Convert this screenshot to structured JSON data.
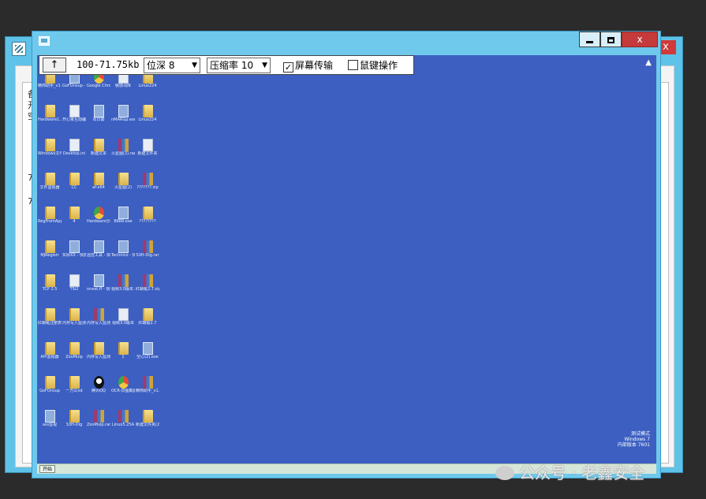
{
  "background_window": {
    "close_glyph": "x",
    "text_lines": [
      "备",
      "开",
      "空",
      "7",
      "7"
    ]
  },
  "main_window": {
    "min_label": "",
    "max_label": "",
    "close_label": "x"
  },
  "toolbar": {
    "up_label": "↑",
    "range": "100-71.75kb",
    "depth_select": "位深 8",
    "compress_select": "压缩率 10",
    "screen_transfer_label": "屏幕传输",
    "screen_transfer_checked": true,
    "input_control_label": "鼠键操作",
    "input_control_checked": false
  },
  "desktop": {
    "icons": [
      {
        "label": "精简助手_v1.87",
        "type": "folder"
      },
      {
        "label": "GoFOnsup - 快捷方式",
        "type": "exe"
      },
      {
        "label": "Google Chrome",
        "type": "chrome"
      },
      {
        "label": "敏感词库",
        "type": "file"
      },
      {
        "label": "Linux224",
        "type": "folder"
      },
      {
        "label": "Hardware1..",
        "type": "folder"
      },
      {
        "label": "开心果互动编辑",
        "type": "file"
      },
      {
        "label": "向日葵",
        "type": "exe"
      },
      {
        "label": "nMARGp.exe - 快捷方式",
        "type": "exe"
      },
      {
        "label": "Linux224",
        "type": "folder"
      },
      {
        "label": "Windows文件监视器 v1.0",
        "type": "folder"
      },
      {
        "label": "Desktop.ini",
        "type": "file"
      },
      {
        "label": "新建文本",
        "type": "folder"
      },
      {
        "label": "火星图(2).rar",
        "type": "rar"
      },
      {
        "label": "新建文件夹",
        "type": "file"
      },
      {
        "label": "文件监视器",
        "type": "folder"
      },
      {
        "label": "CC",
        "type": "folder"
      },
      {
        "label": "af-x64",
        "type": "folder"
      },
      {
        "label": "火星图(2)",
        "type": "folder"
      },
      {
        "label": "???????.zip",
        "type": "rar"
      },
      {
        "label": "RegFromApp v1.33",
        "type": "folder"
      },
      {
        "label": "4",
        "type": "folder"
      },
      {
        "label": "Hardware分析工",
        "type": "chrome"
      },
      {
        "label": "8888.exe",
        "type": "exe"
      },
      {
        "label": "????????",
        "type": "folder"
      },
      {
        "label": "MJRegistr",
        "type": "folder"
      },
      {
        "label": "实际XX - 快捷方式",
        "type": "exe"
      },
      {
        "label": "远控工具 - 快捷方式",
        "type": "exe"
      },
      {
        "label": "Technico - 快捷方式",
        "type": "exe"
      },
      {
        "label": "S3H-Dig.rar",
        "type": "rar"
      },
      {
        "label": "TCP 2.5",
        "type": "folder"
      },
      {
        "label": "TSi2",
        "type": "file"
      },
      {
        "label": "nnext.ff - 快捷方式",
        "type": "exe"
      },
      {
        "label": "视频3.0版本.zip",
        "type": "rar"
      },
      {
        "label": "红蜻蜓2.7.zip",
        "type": "rar"
      },
      {
        "label": "红蜻蜓注册表监视工具(...",
        "type": "folder"
      },
      {
        "label": "内存写入监测器(2)",
        "type": "folder"
      },
      {
        "label": "内存写入监测器 v2.0.rar",
        "type": "rar"
      },
      {
        "label": "视频3.0版本",
        "type": "file"
      },
      {
        "label": "红蜻蜓2.7",
        "type": "folder"
      },
      {
        "label": "API监视器",
        "type": "folder"
      },
      {
        "label": "ZooMulp",
        "type": "folder"
      },
      {
        "label": "内存写入监测器 v2.0",
        "type": "folder"
      },
      {
        "label": "1",
        "type": "folder"
      },
      {
        "label": "空心(2).exe",
        "type": "exe"
      },
      {
        "label": "GoFOnsup",
        "type": "folder"
      },
      {
        "label": "一万公vd",
        "type": "folder"
      },
      {
        "label": "腾讯QQ",
        "type": "qq"
      },
      {
        "label": "OCR-识图截图等",
        "type": "chrome"
      },
      {
        "label": "精简助手_v1.87.zip",
        "type": "rar"
      },
      {
        "label": "ass监视",
        "type": "exe"
      },
      {
        "label": "S3H-Dig",
        "type": "folder"
      },
      {
        "label": "ZooMulp.rar",
        "type": "rar"
      },
      {
        "label": "Linux5.25A",
        "type": "rar"
      },
      {
        "label": "新建文件夹(2)",
        "type": "folder"
      }
    ],
    "watermark_lines": [
      "测试模式",
      "Windows 7",
      "内部版本 7601"
    ]
  },
  "taskbar": {
    "start_label": "开始"
  },
  "overlay": {
    "brand_text": "公众号 · 老鑫安全"
  }
}
